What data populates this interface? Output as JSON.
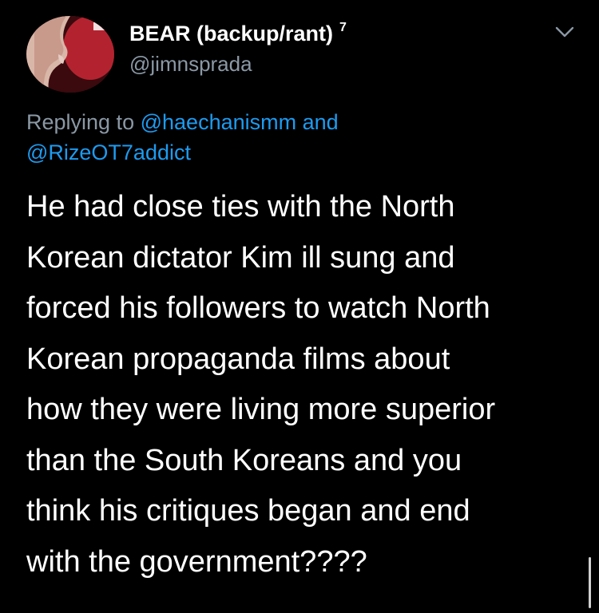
{
  "tweet": {
    "author": {
      "display_name": "BEAR (backup/rant)",
      "badge": "7",
      "handle": "@jimnsprada",
      "avatar": "avatar-photo"
    },
    "menu_icon": "chevron-down-icon",
    "reply_context": {
      "prefix": "Replying to",
      "mention_1": "@haechanismm",
      "conjunction": "and",
      "mention_2": "@RizeOT7addict"
    },
    "body_lines": [
      "He had close ties with the North",
      "Korean dictator Kim ill sung and",
      "forced his followers to watch North",
      "Korean propaganda films about",
      "how they were living more superior",
      "than the South Koreans and you",
      "think his critiques began and end",
      "with the government????"
    ]
  },
  "colors": {
    "background": "#000000",
    "text": "#ffffff",
    "secondary": "#8b98a5",
    "link": "#1d9bf0"
  }
}
